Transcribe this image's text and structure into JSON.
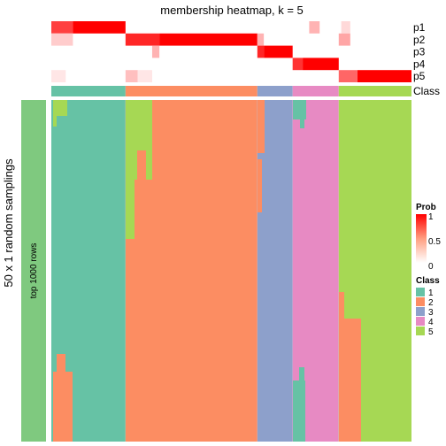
{
  "chart_data": {
    "type": "heatmap",
    "title": "membership heatmap, k = 5",
    "row_annotation_labels": [
      "p1",
      "p2",
      "p3",
      "p4",
      "p5",
      "Class"
    ],
    "left_outer_label": "50 x 1 random samplings",
    "left_group_label": "top 1000 rows",
    "left_group_color": "#7FC97F",
    "legend_prob": {
      "title": "Prob",
      "ticks": [
        "1",
        "0.5",
        "0"
      ],
      "range": [
        0,
        1
      ],
      "low_color": "#FFFFFF",
      "high_color": "#FF0000"
    },
    "legend_class": {
      "title": "Class",
      "items": [
        {
          "label": "1",
          "color": "#66C2A5"
        },
        {
          "label": "2",
          "color": "#FC8D62"
        },
        {
          "label": "3",
          "color": "#8DA0CB"
        },
        {
          "label": "4",
          "color": "#E78AC3"
        },
        {
          "label": "5",
          "color": "#A6D854"
        }
      ]
    },
    "column_groups": [
      {
        "class": "1",
        "fraction": 0.206
      },
      {
        "class": "2",
        "fraction": 0.366
      },
      {
        "class": "3",
        "fraction": 0.098
      },
      {
        "class": "4",
        "fraction": 0.128
      },
      {
        "class": "5",
        "fraction": 0.202
      }
    ],
    "n_samplings": 50,
    "prob_rows": [
      {
        "name": "p1",
        "segments": [
          [
            0,
            0.06,
            0.75
          ],
          [
            0.06,
            0.206,
            1.0
          ],
          [
            0.206,
            1,
            0.0
          ],
          [
            0.716,
            0.745,
            0.3
          ],
          [
            0.805,
            0.83,
            0.15
          ]
        ]
      },
      {
        "name": "p2",
        "segments": [
          [
            0,
            0.06,
            0.2
          ],
          [
            0.206,
            0.3,
            0.85
          ],
          [
            0.3,
            0.572,
            1.0
          ],
          [
            0.572,
            0.59,
            0.3
          ],
          [
            0.798,
            0.83,
            0.35
          ]
        ]
      },
      {
        "name": "p3",
        "segments": [
          [
            0.28,
            0.3,
            0.3
          ],
          [
            0.572,
            0.59,
            0.85
          ],
          [
            0.59,
            0.67,
            1.0
          ]
        ]
      },
      {
        "name": "p4",
        "segments": [
          [
            0.67,
            0.698,
            0.8
          ],
          [
            0.698,
            0.798,
            1.0
          ]
        ]
      },
      {
        "name": "p5",
        "segments": [
          [
            0,
            0.04,
            0.1
          ],
          [
            0.206,
            0.24,
            0.25
          ],
          [
            0.24,
            0.28,
            0.1
          ],
          [
            0.798,
            0.85,
            0.6
          ],
          [
            0.85,
            1.0,
            1.0
          ]
        ]
      }
    ]
  }
}
